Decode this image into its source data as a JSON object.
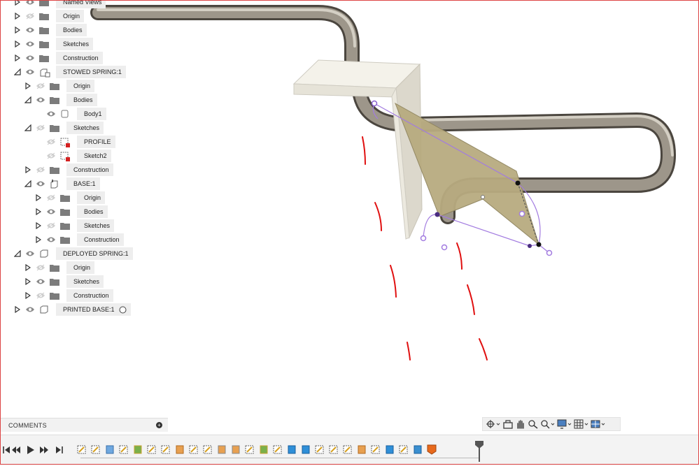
{
  "browser": {
    "partial_top_label": "Named Views",
    "items": [
      {
        "label": "Origin",
        "level": 1,
        "expanded": false,
        "visible": false,
        "icon": "folder-icon"
      },
      {
        "label": "Bodies",
        "level": 1,
        "expanded": false,
        "visible": true,
        "icon": "folder-icon"
      },
      {
        "label": "Sketches",
        "level": 1,
        "expanded": false,
        "visible": true,
        "icon": "folder-icon"
      },
      {
        "label": "Construction",
        "level": 1,
        "expanded": false,
        "visible": true,
        "icon": "folder-icon"
      },
      {
        "label": "STOWED SPRING:1",
        "level": 1,
        "expanded": true,
        "visible": true,
        "icon": "component-link-icon"
      },
      {
        "label": "Origin",
        "level": 2,
        "expanded": false,
        "visible": false,
        "icon": "folder-icon"
      },
      {
        "label": "Bodies",
        "level": 2,
        "expanded": true,
        "visible": true,
        "icon": "folder-icon"
      },
      {
        "label": "Body1",
        "level": 3,
        "expanded": null,
        "visible": true,
        "icon": "body-icon"
      },
      {
        "label": "Sketches",
        "level": 2,
        "expanded": true,
        "visible": false,
        "icon": "folder-icon"
      },
      {
        "label": "PROFILE",
        "level": 3,
        "expanded": null,
        "visible": false,
        "icon": "sketch-icon"
      },
      {
        "label": "Sketch2",
        "level": 3,
        "expanded": null,
        "visible": false,
        "icon": "sketch-icon"
      },
      {
        "label": "Construction",
        "level": 2,
        "expanded": false,
        "visible": false,
        "icon": "folder-icon"
      },
      {
        "label": "BASE:1",
        "level": 2,
        "expanded": true,
        "visible": true,
        "icon": "component-ground-icon"
      },
      {
        "label": "Origin",
        "level": 3,
        "expanded": false,
        "visible": false,
        "icon": "folder-icon"
      },
      {
        "label": "Bodies",
        "level": 3,
        "expanded": false,
        "visible": true,
        "icon": "folder-icon"
      },
      {
        "label": "Sketches",
        "level": 3,
        "expanded": false,
        "visible": false,
        "icon": "folder-icon"
      },
      {
        "label": "Construction",
        "level": 3,
        "expanded": false,
        "visible": true,
        "icon": "folder-icon"
      },
      {
        "label": "DEPLOYED SPRING:1",
        "level": 1,
        "expanded": true,
        "visible": true,
        "icon": "component-icon"
      },
      {
        "label": "Origin",
        "level": 2,
        "expanded": false,
        "visible": false,
        "icon": "folder-icon"
      },
      {
        "label": "Sketches",
        "level": 2,
        "expanded": false,
        "visible": true,
        "icon": "folder-icon"
      },
      {
        "label": "Construction",
        "level": 2,
        "expanded": false,
        "visible": false,
        "icon": "folder-icon"
      },
      {
        "label": "PRINTED BASE:1",
        "level": 1,
        "expanded": false,
        "visible": true,
        "icon": "component-icon",
        "radio": true
      }
    ]
  },
  "comments": {
    "label": "COMMENTS"
  },
  "nav_toolbar": {
    "buttons": [
      "orbit-icon",
      "look-at-icon",
      "pan-icon",
      "zoom-icon",
      "fit-icon",
      "display-settings-icon",
      "grid-settings-icon",
      "viewports-icon"
    ]
  },
  "timeline": {
    "controls": [
      "go-to-start-icon",
      "step-back-icon",
      "play-icon",
      "step-forward-icon",
      "go-to-end-icon"
    ],
    "features": [
      "sketch",
      "sketch",
      "extrude",
      "sketch",
      "split",
      "sketch",
      "sketch",
      "fillet",
      "sketch",
      "sketch",
      "combine",
      "combine",
      "sketch",
      "split",
      "sketch",
      "body",
      "body",
      "sketch",
      "sketch",
      "sketch",
      "fillet",
      "sketch",
      "body",
      "sketch",
      "assembly",
      "marker"
    ]
  },
  "colors": {
    "tube": "#9a9388",
    "base": "#efede4",
    "blade": "#b8ab80",
    "sketch_curve": "#a27be0",
    "annotation": "#e01010",
    "accent": "#e8691c"
  }
}
